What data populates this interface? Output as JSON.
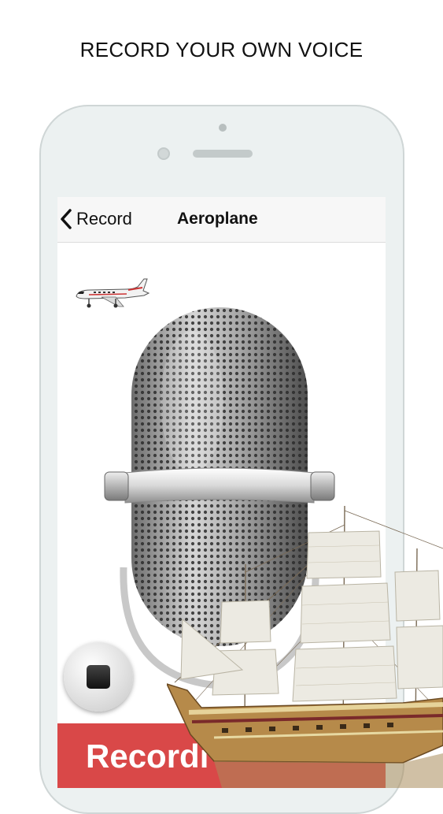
{
  "headline": "RECORD YOUR OWN VOICE",
  "navbar": {
    "back_label": "Record",
    "title": "Aeroplane"
  },
  "icons": {
    "back": "chevron-left-icon",
    "stop": "stop-icon",
    "thumbnail": "aeroplane-thumbnail",
    "microphone": "microphone-illustration",
    "ship": "sailing-ship-illustration"
  },
  "record_bar": {
    "label": "Recordi"
  },
  "colors": {
    "record_bar": "#d94848",
    "phone_frame": "#ecf1f1",
    "navbar": "#f7f7f7"
  }
}
